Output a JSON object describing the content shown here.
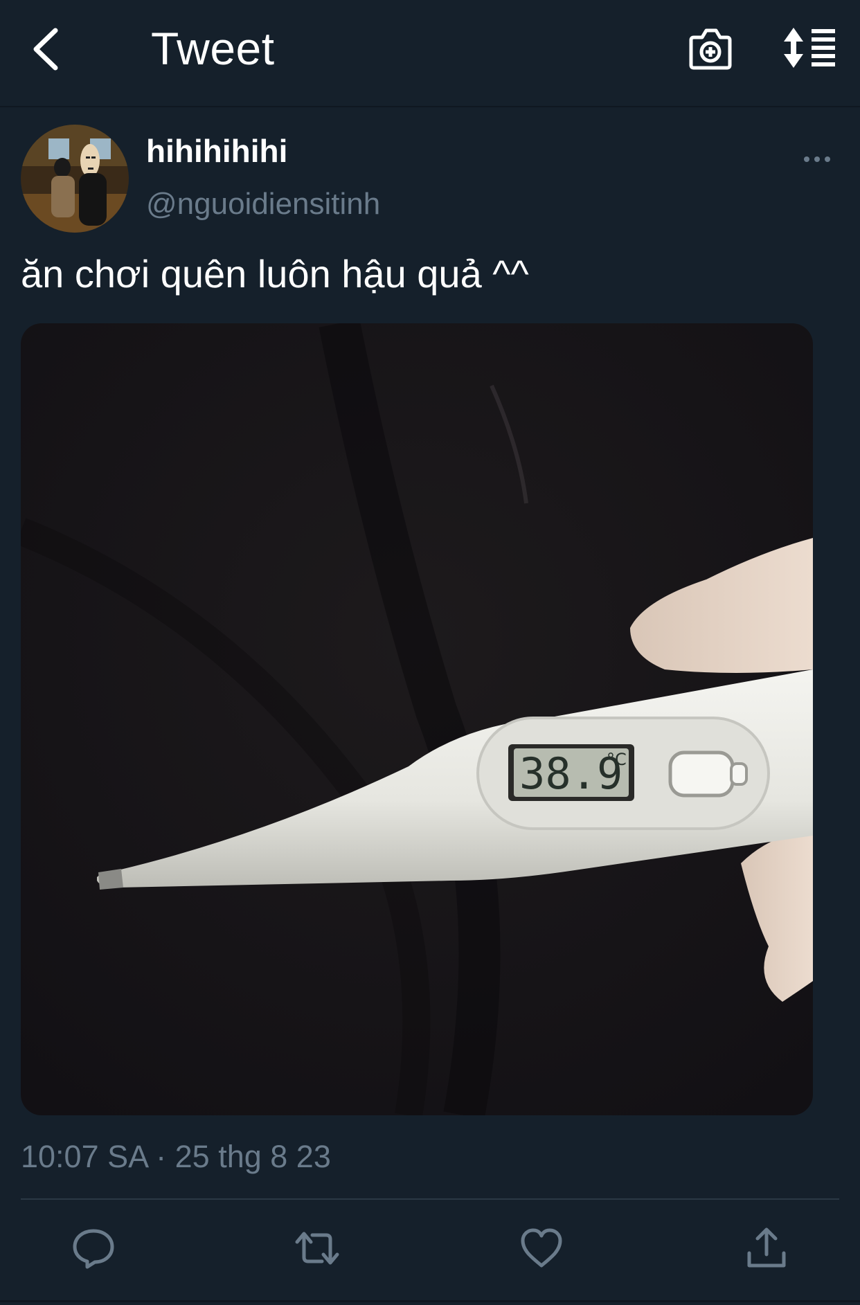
{
  "header": {
    "title": "Tweet",
    "back_icon": "chevron-left-icon",
    "camera_icon": "camera-plus-icon",
    "sort_icon": "sort-list-icon"
  },
  "tweet": {
    "display_name": "hihihihihi",
    "handle": "@nguoidiensitinh",
    "text": "ăn chơi quên luôn hậu quả ^^",
    "timestamp": "10:07 SA · 25 thg 8 23",
    "media": {
      "description_icon": "thermometer-photo",
      "thermometer_reading": "38.9",
      "thermometer_unit": "°C"
    }
  },
  "actions": [
    {
      "name": "reply",
      "icon": "reply-icon"
    },
    {
      "name": "retweet",
      "icon": "retweet-icon"
    },
    {
      "name": "like",
      "icon": "heart-icon"
    },
    {
      "name": "share",
      "icon": "share-icon"
    }
  ],
  "colors": {
    "background": "#15202b",
    "secondary_text": "#6a7b8b",
    "divider": "#2b3845"
  }
}
